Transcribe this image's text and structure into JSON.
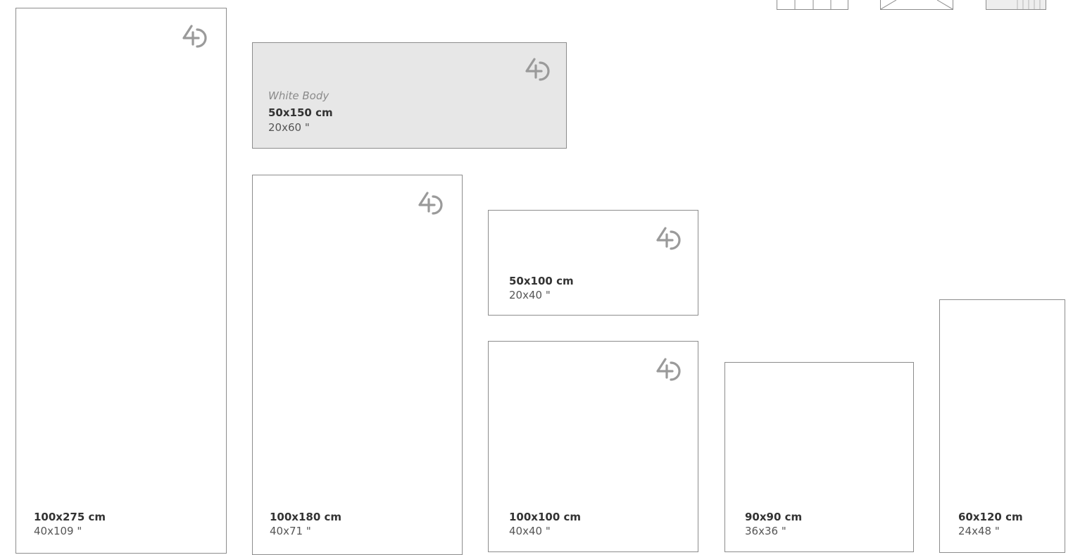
{
  "tiles": [
    {
      "cm": "100x275 cm",
      "in": "40x109 \""
    },
    {
      "finish": "White Body",
      "cm": "50x150 cm",
      "in": "20x60 \""
    },
    {
      "cm": "100x180 cm",
      "in": "40x71 \""
    },
    {
      "cm": "50x100 cm",
      "in": "20x40 \""
    },
    {
      "cm": "100x100 cm",
      "in": "40x40 \""
    },
    {
      "cm": "90x90 cm",
      "in": "36x36 \""
    },
    {
      "cm": "60x120 cm",
      "in": "24x48 \""
    }
  ],
  "icons": [
    "grid-pattern-icon",
    "envelope-pattern-icon",
    "stripe-pattern-icon"
  ],
  "colors": {
    "border": "#8c8c8c",
    "shaded_tile": "#e7e7e7",
    "logo": "#9a9a9a"
  }
}
